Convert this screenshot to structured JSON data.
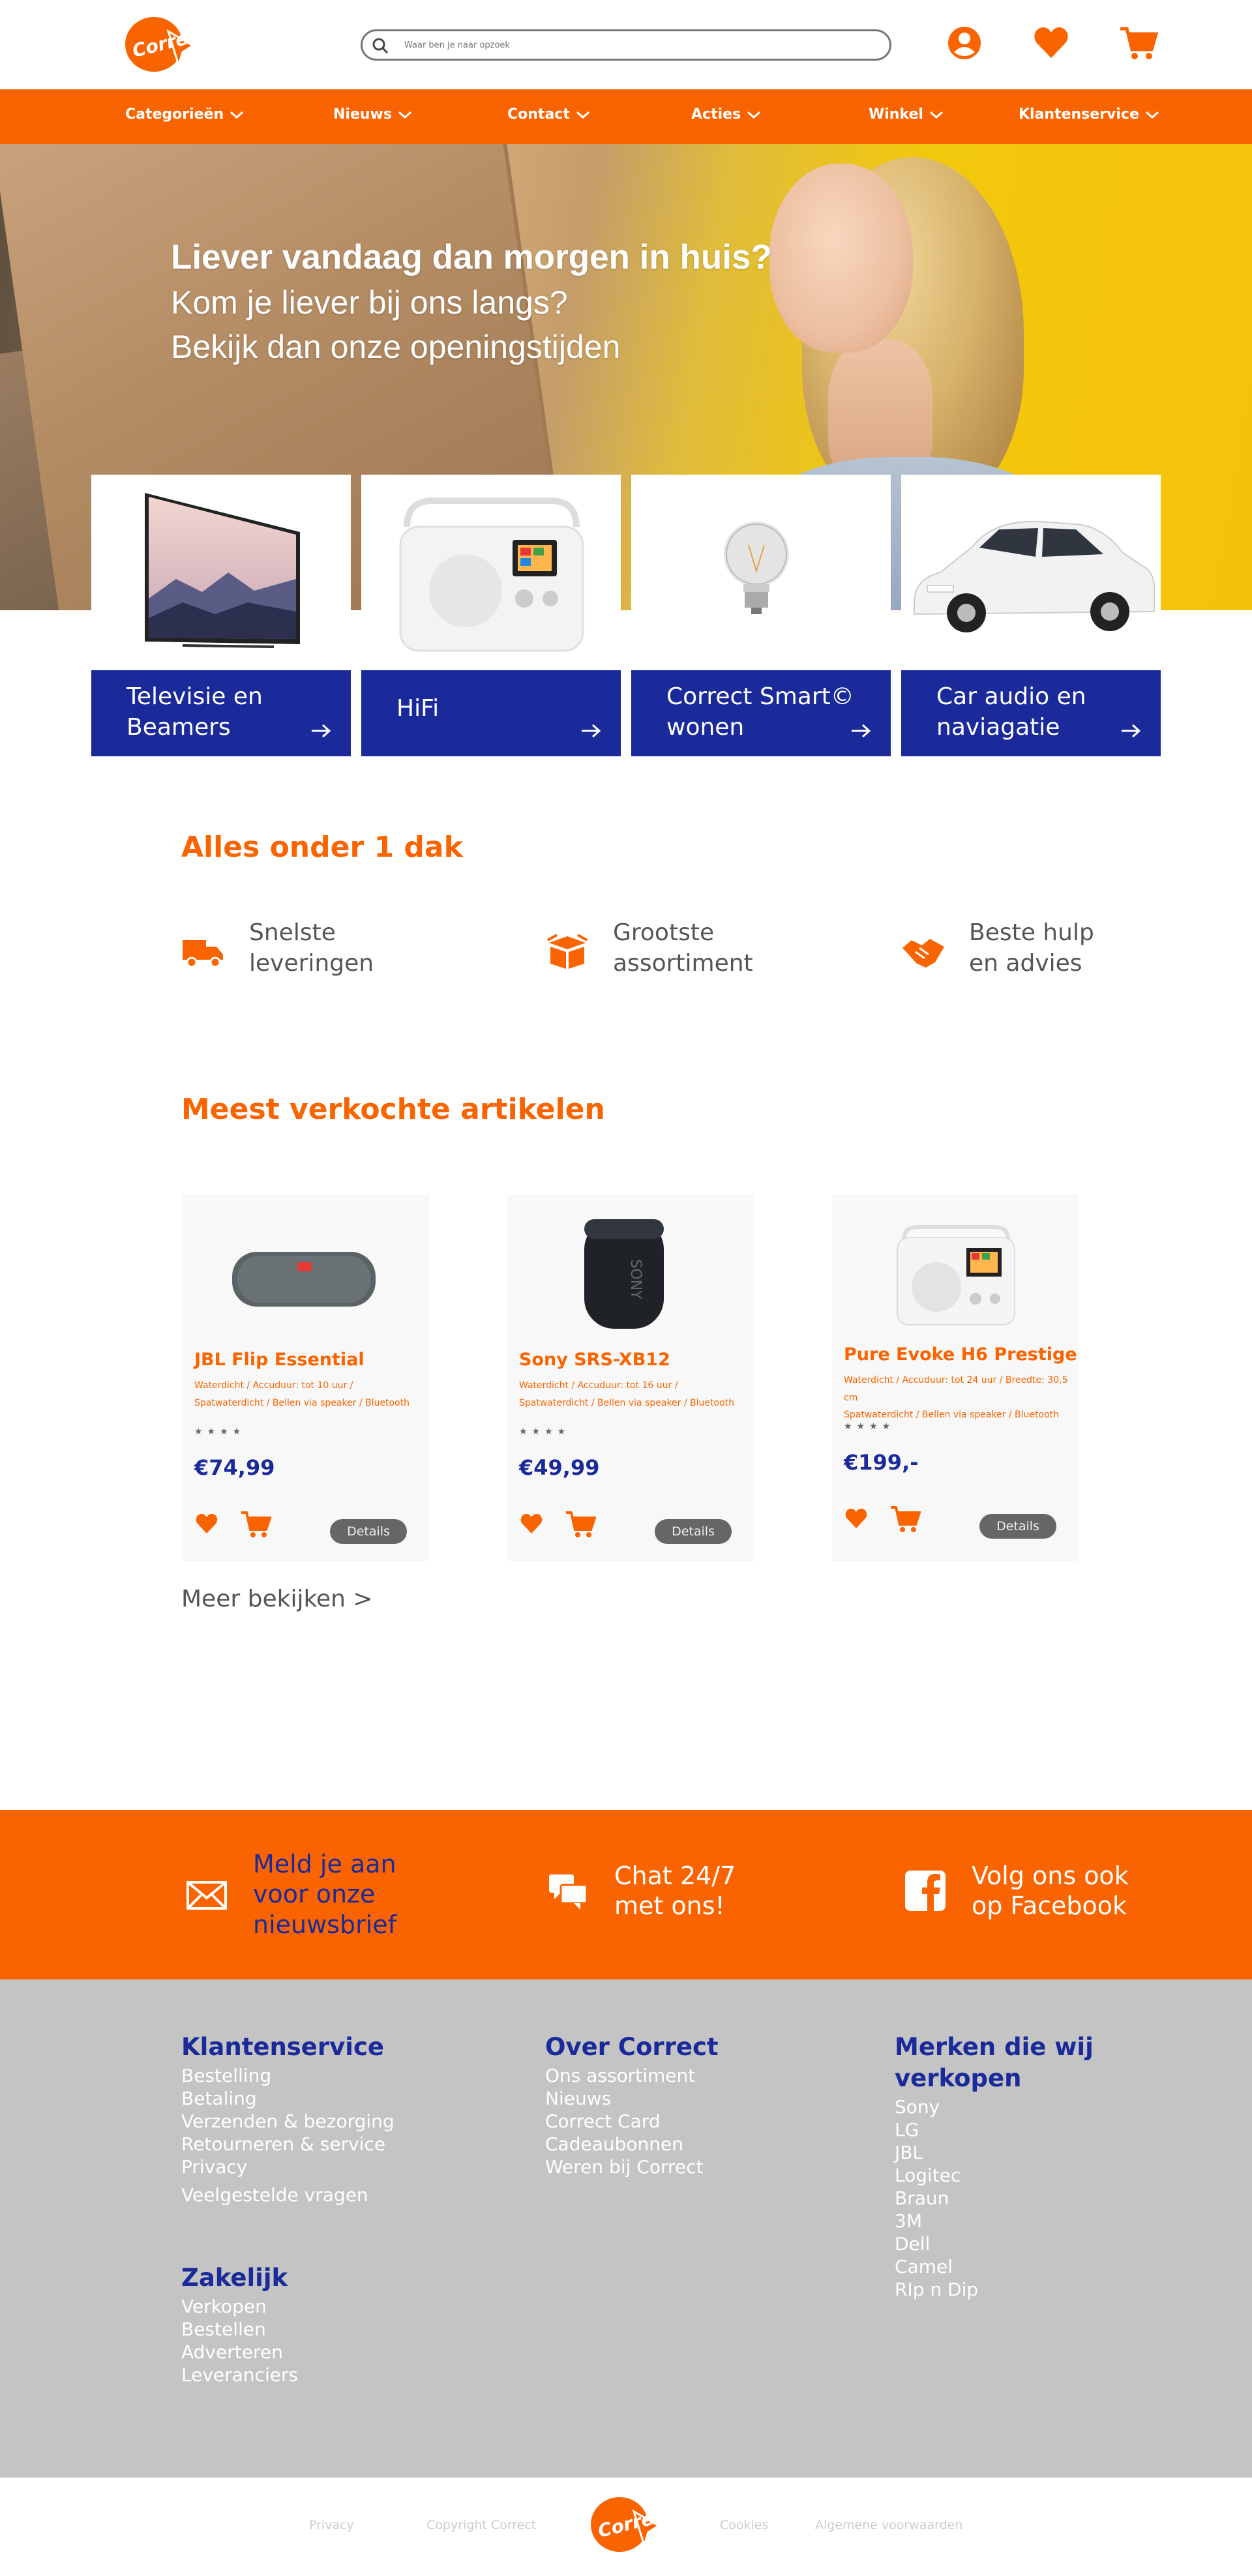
{
  "colors": {
    "brand_orange": "#fa6400",
    "brand_blue": "#1a2a9a",
    "footer_gray": "#c4c4c4"
  },
  "header": {
    "logo_text": "Correct",
    "search_placeholder": "Waar ben je naar opzoek",
    "icons": [
      "account-icon",
      "heart-icon",
      "cart-icon"
    ]
  },
  "nav": {
    "items": [
      {
        "label": "Categorieën"
      },
      {
        "label": "Nieuws"
      },
      {
        "label": "Contact"
      },
      {
        "label": "Acties"
      },
      {
        "label": "Winkel"
      },
      {
        "label": "Klantenservice"
      }
    ]
  },
  "hero": {
    "title": "Liever vandaag dan morgen in huis?",
    "line1": "Kom je liever bij ons langs?",
    "line2": "Bekijk dan onze openingstijden"
  },
  "categories": [
    {
      "label": "Televisie en Beamers",
      "icon": "tv-image"
    },
    {
      "label": "HiFi",
      "icon": "radio-image"
    },
    {
      "label": "Correct Smart© wonen",
      "icon": "bulb-image"
    },
    {
      "label": "Car audio en naviagatie",
      "icon": "car-image"
    }
  ],
  "usps": {
    "title": "Alles onder 1 dak",
    "items": [
      {
        "text": "Snelste leveringen",
        "icon": "truck-icon"
      },
      {
        "text": "Grootste assortiment",
        "icon": "box-icon"
      },
      {
        "text": "Beste hulp en advies",
        "icon": "handshake-icon"
      }
    ]
  },
  "bestsellers": {
    "title": "Meest verkochte artikelen",
    "more": "Meer bekijken >",
    "products": [
      {
        "name": "JBL Flip Essential",
        "spec1": "Waterdicht / Accuduur: tot 10 uur /",
        "spec2": "Spatwaterdicht / Bellen via speaker / Bluetooth",
        "stars": "★★★★",
        "price": "€74,99",
        "details": "Details"
      },
      {
        "name": "Sony SRS-XB12",
        "spec1": "Waterdicht / Accuduur: tot 16 uur /",
        "spec2": "Spatwaterdicht / Bellen via speaker / Bluetooth",
        "stars": "★★★★",
        "price": "€49,99",
        "details": "Details"
      },
      {
        "name": "Pure Evoke H6 Prestige",
        "spec1": "Waterdicht / Accuduur: tot 24 uur / Breedte: 30,5 cm",
        "spec2": "Spatwaterdicht / Bellen via speaker / Bluetooth",
        "stars": "★★★★",
        "price": "€199,-",
        "details": "Details"
      }
    ]
  },
  "band": {
    "newsletter": "Meld je aan voor onze nieuwsbrief",
    "chat": "Chat 24/7 met ons!",
    "facebook": "Volg ons ook op Facebook"
  },
  "footer": {
    "klantenservice": {
      "title": "Klantenservice",
      "links": [
        "Bestelling",
        "Betaling",
        "Verzenden & bezorging",
        "Retourneren & service",
        "Privacy",
        "Veelgestelde vragen"
      ]
    },
    "zakelijk": {
      "title": "Zakelijk",
      "links": [
        "Verkopen",
        "Bestellen",
        "Adverteren",
        "Leveranciers"
      ]
    },
    "over": {
      "title": "Over Correct",
      "links": [
        "Ons assortiment",
        "Nieuws",
        "Correct Card",
        "Cadeaubonnen",
        "Weren bij Correct"
      ]
    },
    "merken": {
      "title": "Merken die wij verkopen",
      "links": [
        "Sony",
        "LG",
        "JBL",
        "Logitec",
        "Braun",
        "3M",
        "Dell",
        "Camel",
        "RIp n Dip"
      ]
    }
  },
  "bottom": {
    "privacy": "Privacy",
    "copyright": "Copyright Correct",
    "cookies": "Cookies",
    "terms": "Algemene voorwaarden"
  }
}
